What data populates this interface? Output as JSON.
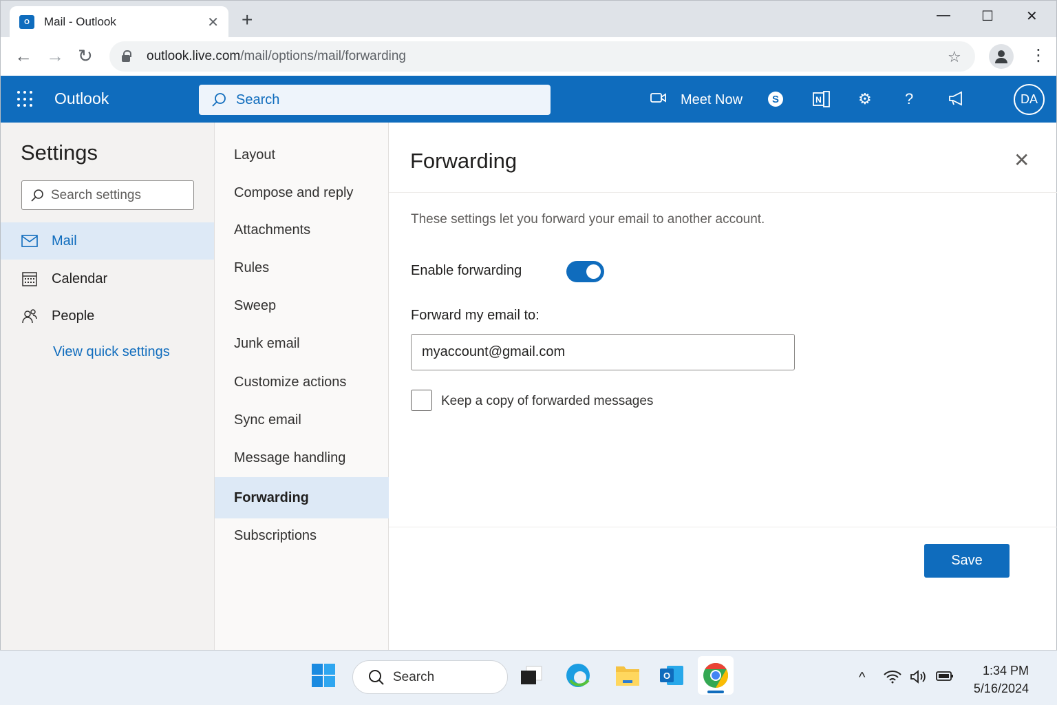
{
  "browser": {
    "tab_title": "Mail - Outlook",
    "favicon_text": "O",
    "url_host": "outlook.live.com",
    "url_path": "/mail/options/mail/forwarding"
  },
  "outlook_header": {
    "brand": "Outlook",
    "search_label": "Search",
    "meet_now": "Meet Now",
    "avatar_initials": "DA"
  },
  "left_nav": {
    "title": "Settings",
    "search_placeholder": "Search settings",
    "items": [
      {
        "label": "Mail",
        "icon": "mail-icon",
        "active": true
      },
      {
        "label": "Calendar",
        "icon": "calendar-icon",
        "active": false
      },
      {
        "label": "People",
        "icon": "people-icon",
        "active": false
      }
    ],
    "quick_link": "View quick settings"
  },
  "mail_settings": {
    "items": [
      "Layout",
      "Compose and reply",
      "Attachments",
      "Rules",
      "Sweep",
      "Junk email",
      "Customize actions",
      "Sync email",
      "Message handling",
      "Forwarding",
      "Subscriptions"
    ],
    "active": "Forwarding"
  },
  "forwarding": {
    "title": "Forwarding",
    "description": "These settings let you forward your email to another account.",
    "enable_label": "Enable forwarding",
    "enabled": true,
    "forward_to_label": "Forward my email to:",
    "forward_to_value": "myaccount@gmail.com",
    "keep_copy_label": "Keep a copy of forwarded messages",
    "keep_copy_checked": false,
    "save_label": "Save"
  },
  "taskbar": {
    "search_label": "Search",
    "time": "1:34 PM",
    "date": "5/16/2024"
  },
  "colors": {
    "accent": "#0f6cbd",
    "selected_bg": "#dde9f6"
  }
}
